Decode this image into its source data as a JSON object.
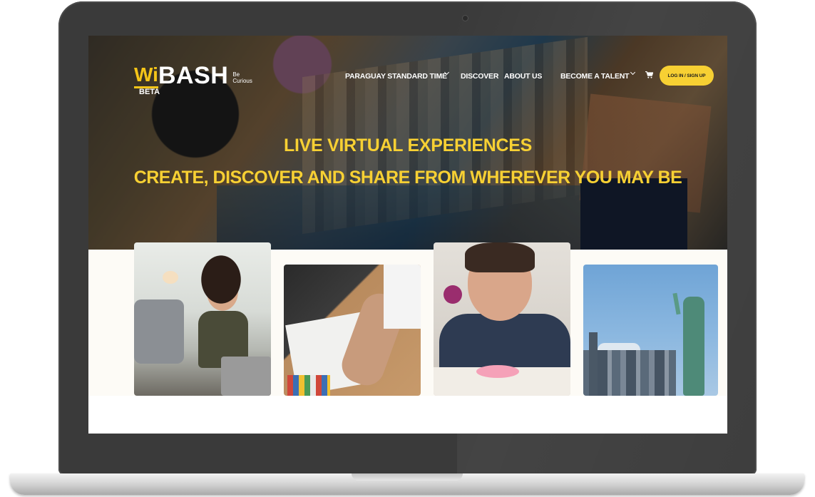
{
  "brand": {
    "logo_wi": "Wi",
    "logo_bash": "BASH",
    "tagline": "Be Curious",
    "beta": "BETA"
  },
  "nav": {
    "items": [
      {
        "label": "PARAGUAY STANDARD TIME",
        "has_dropdown": true
      },
      {
        "label": "DISCOVER",
        "has_dropdown": false
      },
      {
        "label": "ABOUT US",
        "has_dropdown": false
      },
      {
        "label": "BECOME A TALENT",
        "has_dropdown": true
      }
    ],
    "cart_icon": "shopping-cart-icon",
    "login_label": "LOG IN / SIGN UP"
  },
  "hero": {
    "headline": "LIVE VIRTUAL EXPERIENCES",
    "subheadline": "CREATE, DISCOVER AND SHARE FROM WHEREVER YOU MAY BE"
  },
  "colors": {
    "accent": "#f7d033",
    "frame": "#3a3a3a",
    "cards_background": "#fdfbf6"
  },
  "cards": [
    {
      "image": "woman-yoga-laptop-photo"
    },
    {
      "image": "designer-sketching-photo"
    },
    {
      "image": "boy-clay-craft-photo"
    },
    {
      "image": "statue-of-liberty-photo"
    }
  ]
}
